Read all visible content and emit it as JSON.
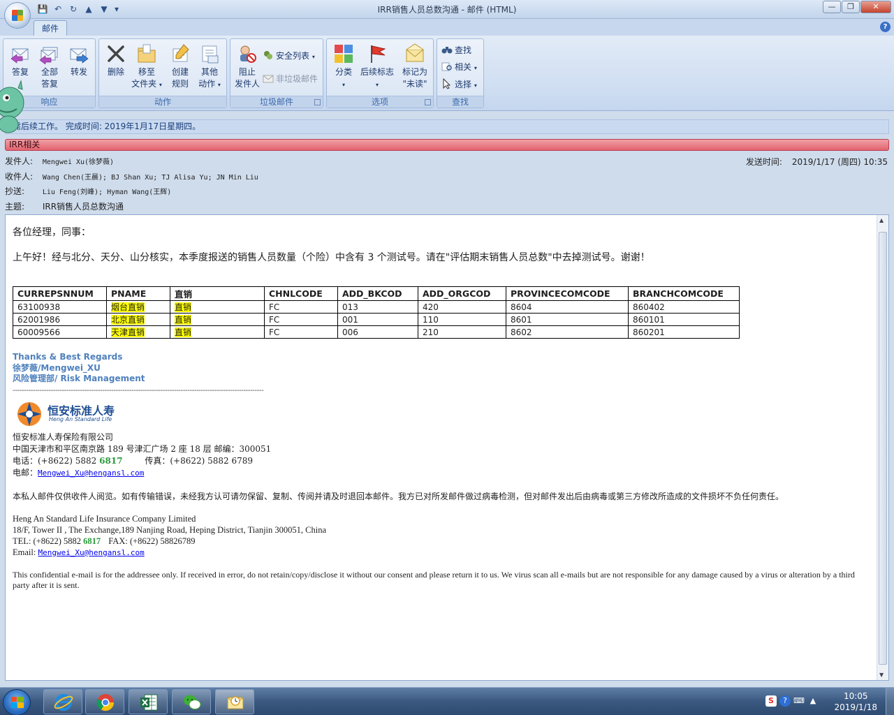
{
  "window": {
    "title": "IRR销售人员总数沟通 - 邮件 (HTML)",
    "controls": [
      "minimize",
      "restore",
      "close"
    ]
  },
  "ribbon": {
    "tab": "邮件",
    "groups": {
      "respond": {
        "label": "响应",
        "reply": "答复",
        "reply_all_1": "全部",
        "reply_all_2": "答复",
        "forward": "转发"
      },
      "actions": {
        "label": "动作",
        "delete": "删除",
        "move_1": "移至",
        "move_2": "文件夹",
        "create_rule_1": "创建",
        "create_rule_2": "规则",
        "other_1": "其他",
        "other_2": "动作"
      },
      "junk": {
        "label": "垃圾邮件",
        "block_1": "阻止",
        "block_2": "发件人",
        "safe_lists": "安全列表",
        "not_junk": "非垃圾邮件"
      },
      "options": {
        "label": "选项",
        "categorize": "分类",
        "follow_up": "后续标志",
        "mark_unread_1": "标记为",
        "mark_unread_2": "\"未读\""
      },
      "find": {
        "label": "查找",
        "find": "查找",
        "related": "相关",
        "select": "选择"
      }
    }
  },
  "infobar": "需后续工作。  完成时间: 2019年1月17日星期四。",
  "category": "IRR相关",
  "header": {
    "from_label": "发件人:",
    "from": "Mengwei Xu(徐梦薇)",
    "to_label": "收件人:",
    "to": "Wang Chen(王晨); BJ Shan Xu; TJ Alisa Yu; JN Min Liu",
    "cc_label": "抄送:",
    "cc": "Liu Feng(刘峰); Hyman Wang(王辉)",
    "subject_label": "主题:",
    "subject": "IRR销售人员总数沟通",
    "sent_label": "发送时间:",
    "sent": "2019/1/17 (周四) 10:35"
  },
  "body": {
    "greeting": "各位经理，同事：",
    "intro": "上午好！经与北分、天分、山分核实，本季度报送的销售人员数量（个险）中含有 3 个测试号。请在\"评估期末销售人员总数\"中去掉测试号。谢谢！",
    "table": {
      "headers": [
        "CURREPSNNUM",
        "PNAME",
        "直销",
        "CHNLCODE",
        "ADD_BKCOD",
        "ADD_ORGCOD",
        "PROVINCECOMCODE",
        "BRANCHCOMCODE"
      ],
      "rows": [
        [
          "63100938",
          "烟台直销",
          "直销",
          "FC",
          "013",
          "420",
          "8604",
          "860402"
        ],
        [
          "62001986",
          "北京直销",
          "直销",
          "FC",
          "001",
          "110",
          "8601",
          "860101"
        ],
        [
          "60009566",
          "天津直销",
          "直销",
          "FC",
          "006",
          "210",
          "8602",
          "860201"
        ]
      ]
    },
    "sig_line1": "Thanks & Best Regards",
    "sig_line2": "徐梦薇/Mengwei_XU",
    "sig_line3": "风险管理部/  Risk Management",
    "dashes": "----------------------------------------------------------------------------------------------------------------",
    "brand_name": "恒安标准人寿",
    "brand_sub": "Heng An Standard Life",
    "company_cn": "恒安标准人寿保险有限公司",
    "address_cn": "中国天津市和平区南京路 189 号津汇广场 2 座 18 层      邮编：300051",
    "tel_cn_prefix": "电话：(+8622) 5882 ",
    "tel_ext": "6817",
    "fax_cn": "传真：(+8622) 5882 6789",
    "email_cn_label": "电邮：",
    "email": "Mengwei_Xu@hengansl.com",
    "disclaimer_cn": "本私人邮件仅供收件人阅览。如有传输错误，未经我方认可请勿保留、复制、传阅并请及时退回本邮件。我方已对所发邮件做过病毒检测，但对邮件发出后由病毒或第三方修改所造成的文件损坏不负任何责任。",
    "company_en": "Heng An Standard Life Insurance Company Limited",
    "address_en": "18/F, Tower II , The Exchange,189 Nanjing Road, Heping District, Tianjin 300051, China",
    "tel_en_prefix": "TEL: (+8622) 5882 ",
    "fax_en": "FAX: (+8622) 58826789",
    "email_en_label": "Email: ",
    "disclaimer_en": "This confidential e-mail is for the addressee only. If received in error, do not retain/copy/disclose it without our consent and please return it to us. We virus scan all e-mails but are not responsible for any damage caused by a virus or alteration by a third party after it is sent."
  },
  "taskbar": {
    "apps": [
      "internet-explorer",
      "chrome",
      "excel",
      "wechat",
      "outlook"
    ],
    "time": "10:05",
    "date": "2019/1/18"
  },
  "colors": {
    "signature_blue": "#4f81bd",
    "highlight_yellow": "#ffff00",
    "category_red": "#e2636e",
    "ext_green": "#2a9a3a"
  }
}
